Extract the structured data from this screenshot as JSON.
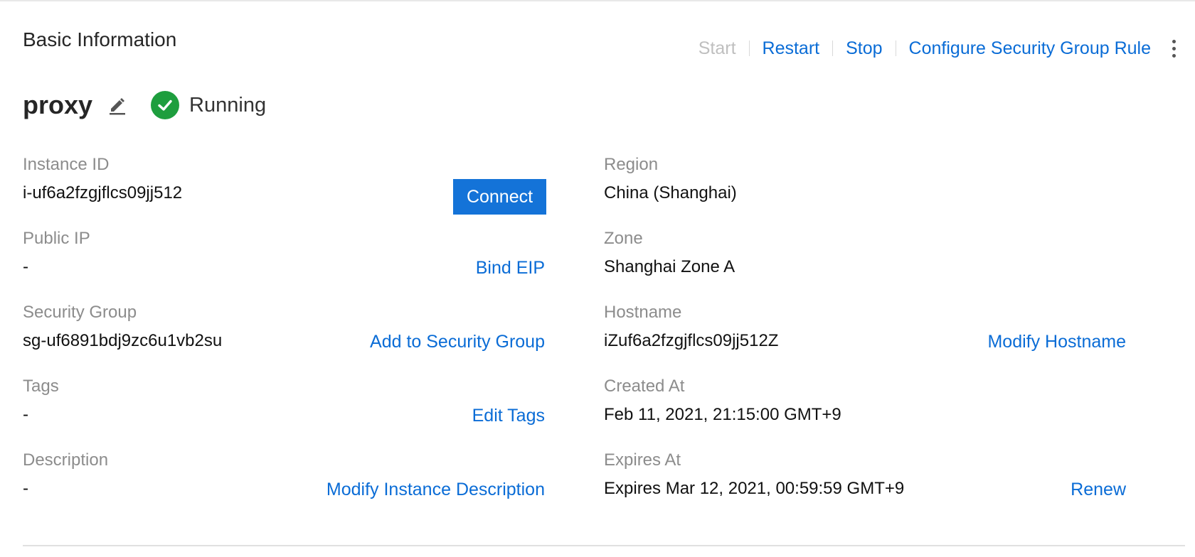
{
  "section": {
    "title": "Basic Information"
  },
  "actions": {
    "start": "Start",
    "restart": "Restart",
    "stop": "Stop",
    "configure_sg": "Configure Security Group Rule"
  },
  "instance": {
    "name": "proxy",
    "status": "Running",
    "status_color": "#1e9e3e"
  },
  "fields": {
    "instance_id": {
      "label": "Instance ID",
      "value": "i-uf6a2fzgjflcs09jj512",
      "action": "Connect"
    },
    "public_ip": {
      "label": "Public IP",
      "value": "-",
      "action": "Bind EIP"
    },
    "security_group": {
      "label": "Security Group",
      "value": "sg-uf6891bdj9zc6u1vb2su",
      "action": "Add to Security Group"
    },
    "tags": {
      "label": "Tags",
      "value": "-",
      "action": "Edit Tags"
    },
    "description": {
      "label": "Description",
      "value": "-",
      "action": "Modify Instance Description"
    },
    "region": {
      "label": "Region",
      "value": "China (Shanghai)"
    },
    "zone": {
      "label": "Zone",
      "value": "Shanghai Zone A"
    },
    "hostname": {
      "label": "Hostname",
      "value": "iZuf6a2fzgjflcs09jj512Z",
      "action": "Modify Hostname"
    },
    "created_at": {
      "label": "Created At",
      "value": "Feb 11, 2021, 21:15:00 GMT+9"
    },
    "expires_at": {
      "label": "Expires At",
      "value": "Expires Mar 12, 2021, 00:59:59 GMT+9",
      "action": "Renew"
    }
  },
  "colors": {
    "link": "#0a6cd6",
    "primary_button": "#1473d8",
    "label": "#8c8c8c"
  },
  "icons": {
    "edit": "pencil-icon",
    "status": "check-circle-icon",
    "more": "more-vertical-icon"
  }
}
